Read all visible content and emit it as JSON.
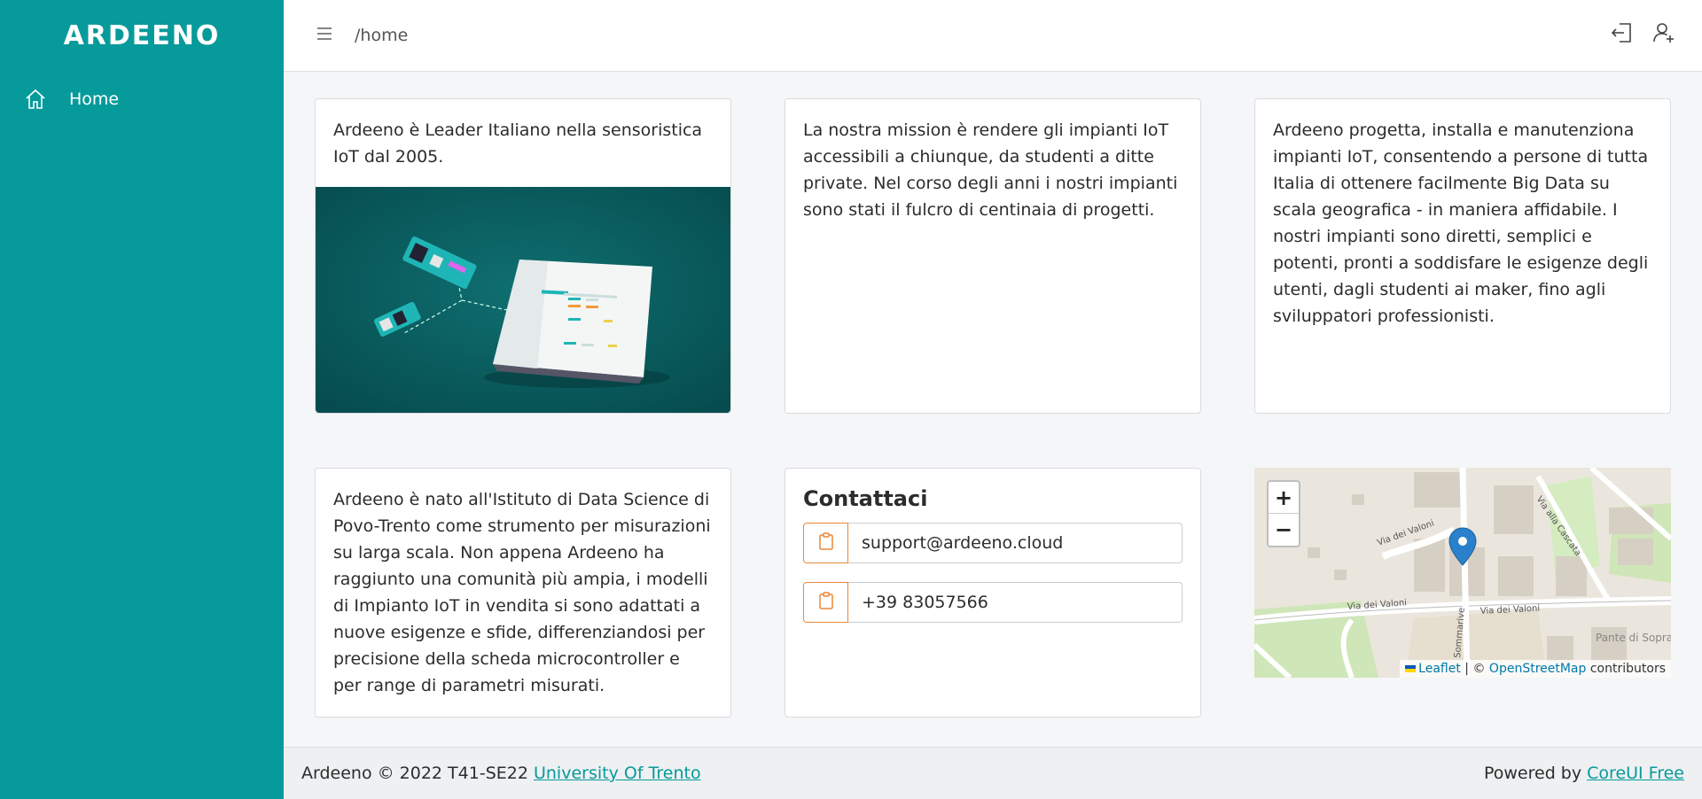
{
  "sidebar": {
    "brand": "ARDEENO",
    "items": [
      {
        "label": "Home",
        "icon": "home-icon"
      }
    ]
  },
  "header": {
    "breadcrumb": "/home",
    "actions": [
      {
        "icon": "logout-icon"
      },
      {
        "icon": "add-user-icon"
      }
    ]
  },
  "cards": {
    "intro": "Ardeeno è Leader Italiano nella sensoristica IoT dal 2005.",
    "mission": "La nostra mission è rendere gli impianti IoT accessibili a chiunque, da studenti a ditte private. Nel corso degli anni i nostri impianti sono stati il fulcro di centinaia di progetti.",
    "services": "Ardeeno progetta, installa e manutenziona impianti IoT, consentendo a persone di tutta Italia di ottenere facilmente Big Data su scala geografica - in maniera affidabile. I nostri impianti sono diretti, semplici e potenti, pronti a soddisfare le esigenze degli utenti, dagli studenti ai maker, fino agli sviluppatori professionisti.",
    "history": "Ardeeno è nato all'Istituto di Data Science di Povo-Trento come strumento per misurazioni su larga scala. Non appena Ardeeno ha raggiunto una comunità più ampia, i modelli di Impianto IoT in vendita si sono adattati a nuove esigenze e sfide, differenziandosi per precisione della scheda microcontroller e per range di parametri misurati."
  },
  "contact": {
    "title": "Contattaci",
    "email": "support@ardeeno.cloud",
    "phone": "+39 83057566"
  },
  "map": {
    "zoom_in": "+",
    "zoom_out": "−",
    "streets": [
      "Via dei Valoni",
      "Via dei Valoni",
      "Via dei Valoni",
      "Via alla Cascata",
      "Sommarive",
      "Pante di Sopra"
    ],
    "attribution": {
      "leaflet": "Leaflet",
      "sep": "| ©",
      "osm": "OpenStreetMap",
      "suffix": "contributors"
    }
  },
  "footer": {
    "left_text": "Ardeeno © 2022 T41-SE22",
    "left_link": "University Of Trento",
    "right_text": "Powered by",
    "right_link": "CoreUI Free"
  },
  "colors": {
    "primary": "#079a9b",
    "accent": "#e8883a",
    "hero_bg": "#0b5a5c"
  }
}
